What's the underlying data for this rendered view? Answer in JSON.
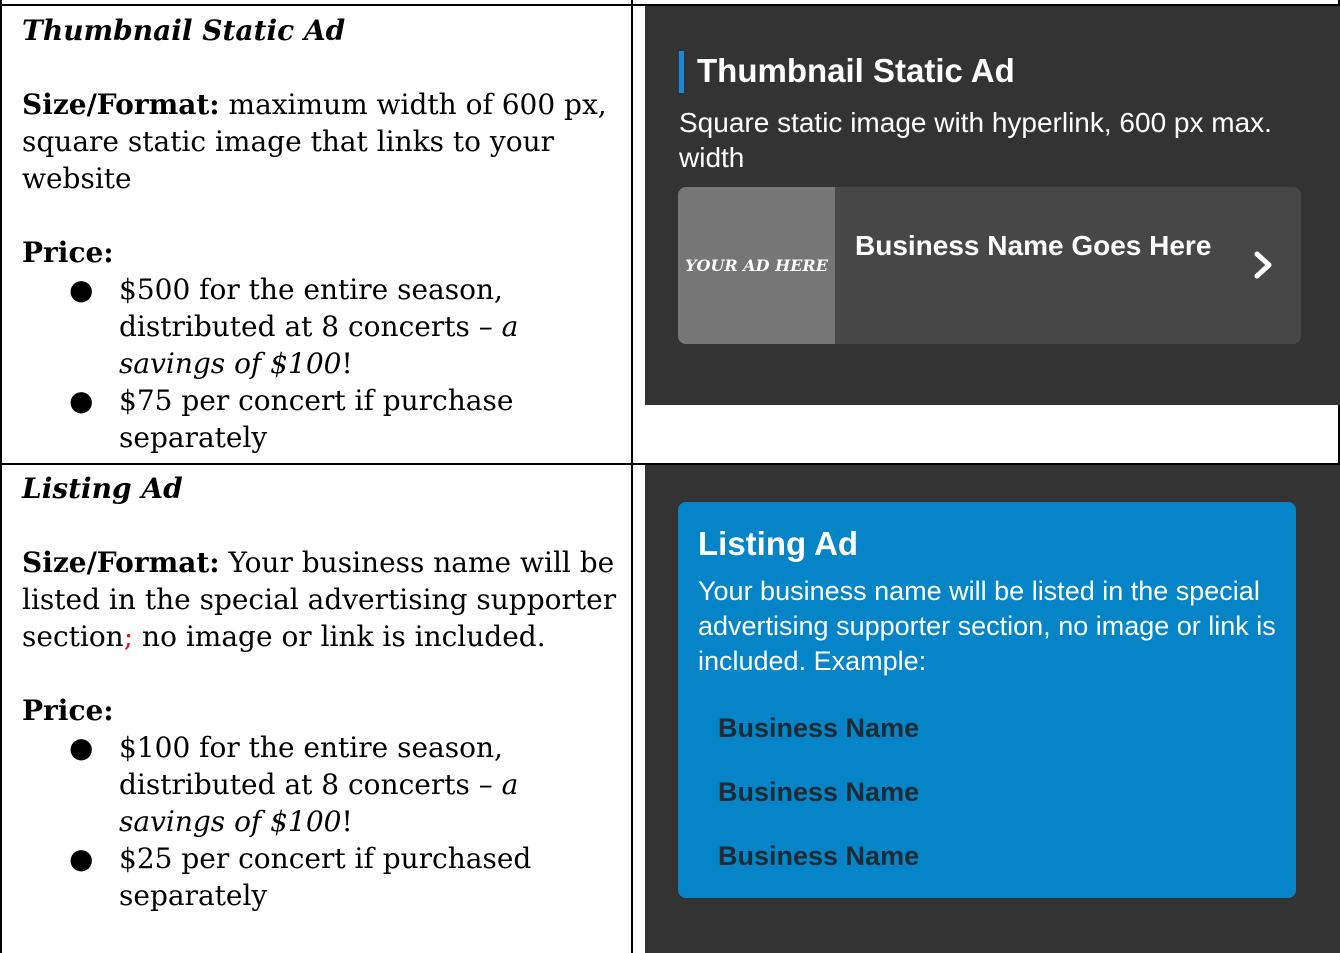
{
  "thumbnail_row": {
    "title": "Thumbnail Static Ad",
    "size_label": "Size/Format:",
    "size_text": " maximum width of 600 px, square static image that links to your website",
    "price_label": "Price:",
    "bullets": [
      {
        "text": "$500 for the entire season, distributed at 8 concerts – ",
        "italic": "a savings of $100",
        "tail": "!"
      },
      {
        "text": "$75 per concert if purchase separately",
        "italic": "",
        "tail": ""
      }
    ],
    "preview": {
      "heading": "Thumbnail Static Ad",
      "description": "Square static image with hyperlink, 600 px max. width",
      "image_placeholder": "YOUR AD HERE",
      "business_name": "Business Name Goes Here",
      "chevron_icon": "chevron-right-icon"
    }
  },
  "listing_row": {
    "title": "Listing Ad",
    "size_label": "Size/Format:",
    "size_text_a": " Your business name will be listed in the special advertising supporter section",
    "size_sep": ";",
    "size_text_b": " no image or link is included.",
    "price_label": "Price:",
    "bullets": [
      {
        "text": "$100 for the entire season, distributed at 8 concerts – ",
        "italic": "a savings of $100",
        "tail": "!"
      },
      {
        "text": "$25 per concert if purchased separately",
        "italic": "",
        "tail": ""
      }
    ],
    "preview": {
      "heading": "Listing Ad",
      "description": "Your business name will be listed in the special advertising supporter section, no image or link is included. Example:",
      "business_names": [
        "Business Name",
        "Business Name",
        "Business Name"
      ]
    }
  },
  "colors": {
    "panel_bg": "#333333",
    "accent": "#1a8ad6",
    "listing_card": "#0584c8",
    "business_name_text": "#202a33",
    "separator_red": "#e0141e"
  }
}
